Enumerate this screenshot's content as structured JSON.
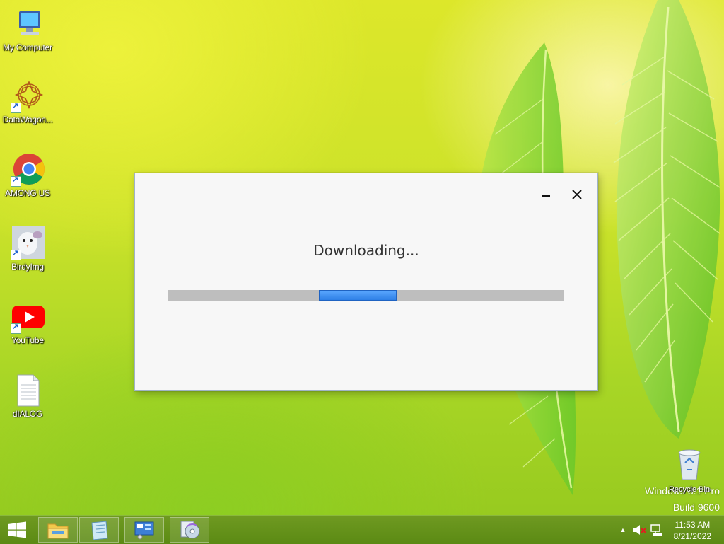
{
  "desktop": {
    "icons": [
      {
        "label": "My Computer",
        "icon": "computer-icon",
        "shortcut": false
      },
      {
        "label": "DataWagon...",
        "icon": "datawagon-icon",
        "shortcut": true
      },
      {
        "label": "AMONG US",
        "icon": "chrome-icon",
        "shortcut": true
      },
      {
        "label": "BirdyImg",
        "icon": "bird-image-icon",
        "shortcut": true
      },
      {
        "label": "YouTube",
        "icon": "youtube-icon",
        "shortcut": true
      },
      {
        "label": "dIALOG",
        "icon": "text-file-icon",
        "shortcut": false
      }
    ],
    "recycle_bin": {
      "label": "Recycle Bin",
      "icon": "recycle-bin-icon"
    },
    "watermark": {
      "line1": "Windows 8.1 Pro",
      "line2": "Build 9600"
    }
  },
  "dialog": {
    "title": "Downloading...",
    "progress": {
      "indeterminate": true,
      "position": "middle"
    },
    "colors": {
      "bar_track": "#bebebe",
      "bar_fill": "#3a8ef0"
    }
  },
  "taskbar": {
    "pinned": [
      {
        "icon": "file-explorer-icon"
      },
      {
        "icon": "notepad-icon"
      },
      {
        "icon": "control-panel-icon"
      },
      {
        "icon": "media-disc-icon"
      }
    ],
    "tray_icons": [
      "show-hidden-icons-arrow",
      "volume-muted-icon",
      "network-icon"
    ],
    "time": "11:53 AM",
    "date": "8/21/2022"
  },
  "colors": {
    "taskbar": "#5e8c16",
    "accent": "#3a8ef0"
  }
}
